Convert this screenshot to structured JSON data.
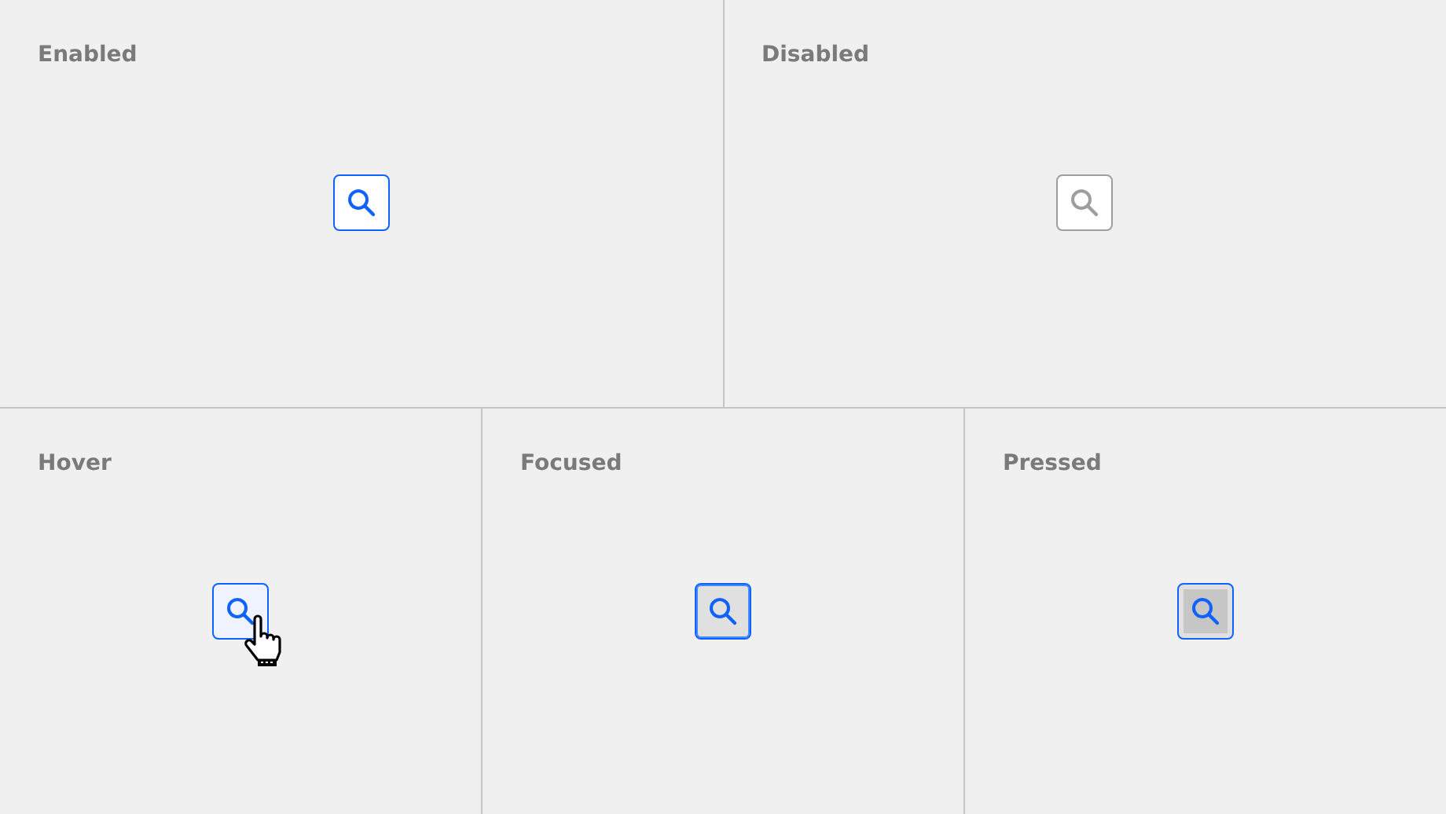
{
  "rows": [
    {
      "panels": [
        {
          "label": "Enabled",
          "kind": "enabled"
        },
        {
          "label": "Disabled",
          "kind": "disabled"
        }
      ]
    },
    {
      "panels": [
        {
          "label": "Hover",
          "kind": "hover"
        },
        {
          "label": "Focused",
          "kind": "focused"
        },
        {
          "label": "Pressed",
          "kind": "pressed"
        }
      ]
    }
  ]
}
